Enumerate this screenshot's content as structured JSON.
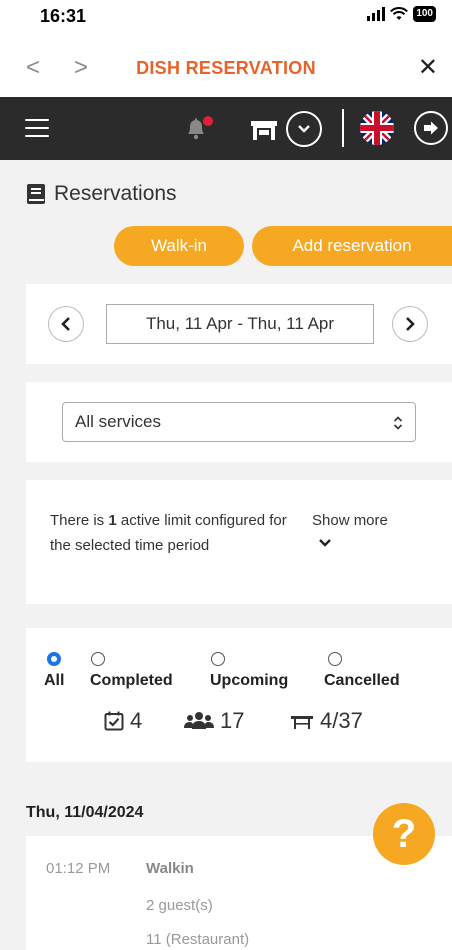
{
  "status_bar": {
    "time": "16:31",
    "battery": "100"
  },
  "browser": {
    "back": "<",
    "forward": ">",
    "title": "DISH RESERVATION",
    "close": "✕"
  },
  "page": {
    "title": "Reservations"
  },
  "actions": {
    "walk_in": "Walk-in",
    "add_reservation": "Add reservation"
  },
  "date_range": {
    "value": "Thu, 11 Apr - Thu, 11 Apr"
  },
  "services": {
    "selected": "All services"
  },
  "limit": {
    "prefix": "There is ",
    "count": "1",
    "suffix": " active limit configured for the selected time period",
    "show_more": "Show more"
  },
  "filters": [
    {
      "label": "All",
      "selected": true
    },
    {
      "label": "Completed",
      "selected": false
    },
    {
      "label": "Upcoming",
      "selected": false
    },
    {
      "label": "Cancelled",
      "selected": false
    }
  ],
  "stats": {
    "reservations": "4",
    "guests": "17",
    "tables": "4/37"
  },
  "day": {
    "heading": "Thu, 11/04/2024",
    "reservation": {
      "time": "01:12 PM",
      "name": "Walkin",
      "guests": "2 guest(s)",
      "table": "11 (Restaurant)"
    }
  },
  "help": {
    "label": "?"
  },
  "colors": {
    "accent": "#f7a823",
    "brand": "#e8622a",
    "header": "#2b2b2b",
    "radio_selected": "#1a73e8",
    "notification": "#e0203a"
  }
}
